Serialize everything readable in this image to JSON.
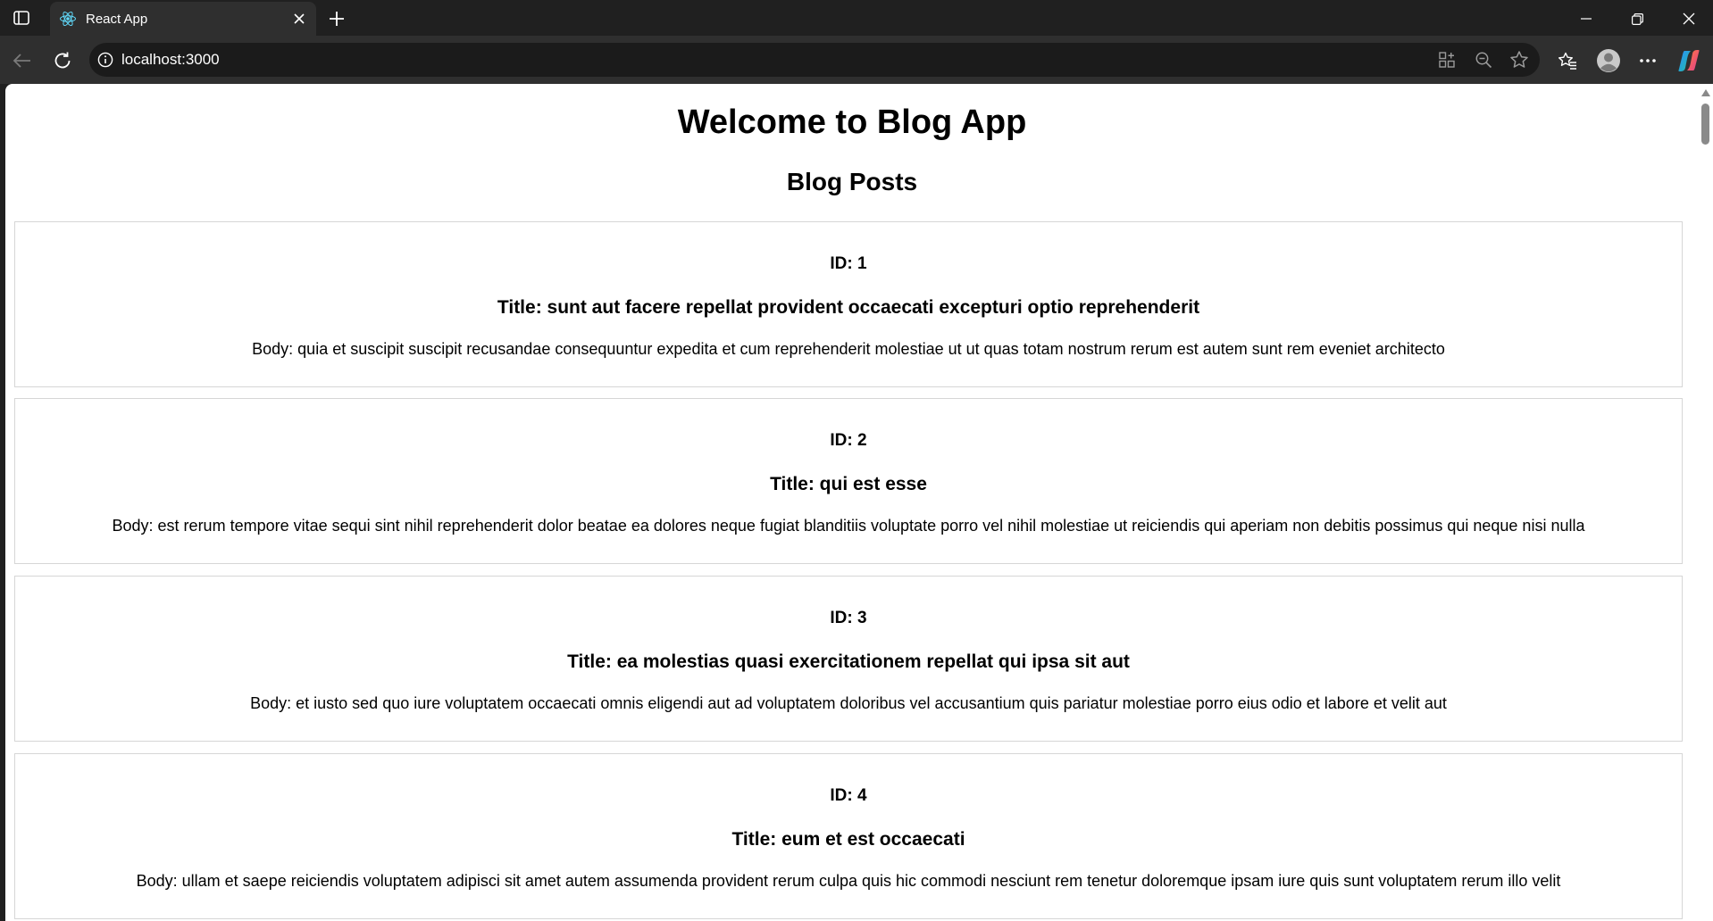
{
  "browser": {
    "tab": {
      "title": "React App"
    },
    "address_bar": {
      "url": "localhost:3000"
    },
    "icons": {
      "tab_actions": "tab-actions-icon",
      "favicon": "react-logo-icon",
      "tab_close": "close-icon",
      "new_tab": "plus-icon",
      "minimize": "minimize-icon",
      "restore": "restore-icon",
      "close_window": "close-icon",
      "back": "back-arrow-icon",
      "refresh": "refresh-icon",
      "site_info": "info-icon",
      "app_available": "apps-icon",
      "zoom": "zoom-out-icon",
      "favorite": "star-icon",
      "favorites_menu": "favorites-icon",
      "profile": "profile-icon",
      "more": "more-icon",
      "copilot": "copilot-icon"
    },
    "colors": {
      "chrome_dark": "#202020",
      "toolbar": "#2f2f2f",
      "omnibox": "#1b1b1b"
    }
  },
  "page": {
    "heading": "Welcome to Blog App",
    "subheading": "Blog Posts",
    "posts": [
      {
        "id": "ID: 1",
        "title": "Title: sunt aut facere repellat provident occaecati excepturi optio reprehenderit",
        "body": "Body: quia et suscipit suscipit recusandae consequuntur expedita et cum reprehenderit molestiae ut ut quas totam nostrum rerum est autem sunt rem eveniet architecto"
      },
      {
        "id": "ID: 2",
        "title": "Title: qui est esse",
        "body": "Body: est rerum tempore vitae sequi sint nihil reprehenderit dolor beatae ea dolores neque fugiat blanditiis voluptate porro vel nihil molestiae ut reiciendis qui aperiam non debitis possimus qui neque nisi nulla"
      },
      {
        "id": "ID: 3",
        "title": "Title: ea molestias quasi exercitationem repellat qui ipsa sit aut",
        "body": "Body: et iusto sed quo iure voluptatem occaecati omnis eligendi aut ad voluptatem doloribus vel accusantium quis pariatur molestiae porro eius odio et labore et velit aut"
      },
      {
        "id": "ID: 4",
        "title": "Title: eum et est occaecati",
        "body": "Body: ullam et saepe reiciendis voluptatem adipisci sit amet autem assumenda provident rerum culpa quis hic commodi nesciunt rem tenetur doloremque ipsam iure quis sunt voluptatem rerum illo velit"
      }
    ]
  }
}
